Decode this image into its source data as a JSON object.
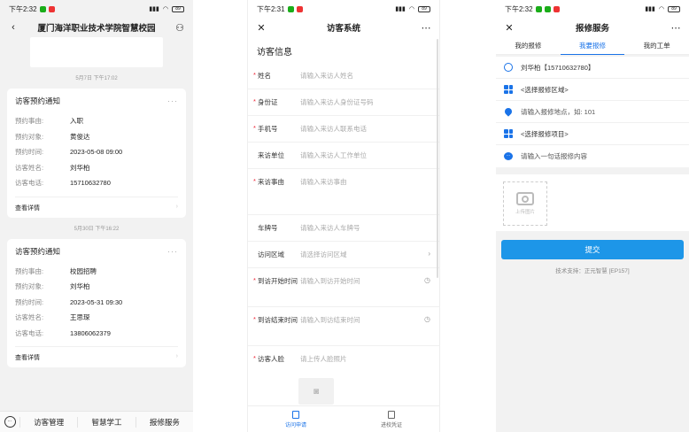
{
  "status_bar": {
    "p1_time": "下午2:32",
    "p2_time": "下午2:31",
    "p3_time": "下午2:32",
    "signal": "all",
    "battery": "89"
  },
  "phone1": {
    "title": "厦门海洋职业技术学院智慧校园",
    "cards": [
      {
        "date": "5月7日 下午17:02",
        "title": "访客预约通知",
        "rows": [
          {
            "k": "预约事由:",
            "v": "入职"
          },
          {
            "k": "预约对象:",
            "v": "黄俊达"
          },
          {
            "k": "预约时间:",
            "v": "2023-05-08 09:00"
          },
          {
            "k": "访客姓名:",
            "v": "刘华柏"
          },
          {
            "k": "访客电话:",
            "v": "15710632780"
          }
        ],
        "footer": "查看详情"
      },
      {
        "date": "5月30日 下午16:22",
        "title": "访客预约通知",
        "rows": [
          {
            "k": "预约事由:",
            "v": "校园招聘"
          },
          {
            "k": "预约对象:",
            "v": "刘华柏"
          },
          {
            "k": "预约时间:",
            "v": "2023-05-31 09:30"
          },
          {
            "k": "访客姓名:",
            "v": "王思琛"
          },
          {
            "k": "访客电话:",
            "v": "13806062379"
          }
        ],
        "footer": "查看详情"
      }
    ],
    "tabbar": [
      "访客管理",
      "智慧学工",
      "报修服务"
    ]
  },
  "phone2": {
    "title": "访客系统",
    "section": "访客信息",
    "fields": [
      {
        "label": "姓名",
        "placeholder": "请输入来访人姓名",
        "req": "*"
      },
      {
        "label": "身份证",
        "placeholder": "请输入来访人身份证号码",
        "req": "*"
      },
      {
        "label": "手机号",
        "placeholder": "请输入来访人联系电话",
        "req": "*"
      },
      {
        "label": "来访单位",
        "placeholder": "请输入来访人工作单位",
        "req": ""
      },
      {
        "label": "来访事由",
        "placeholder": "请输入来访事由",
        "req": "*"
      },
      {
        "label": "车牌号",
        "placeholder": "请输入来访人车牌号",
        "req": ""
      },
      {
        "label": "访问区域",
        "placeholder": "请选择访问区域",
        "req": ""
      },
      {
        "label": "到访开始时间",
        "placeholder": "请输入到访开始时间",
        "req": "*"
      },
      {
        "label": "到访结束时间",
        "placeholder": "请输入到访结束时间",
        "req": "*"
      },
      {
        "label": "访客人脸",
        "placeholder": "请上传人脸照片",
        "req": "*"
      }
    ],
    "tabbar": [
      "访问申请",
      "进校凭证"
    ]
  },
  "phone3": {
    "title": "报修服务",
    "tabs": [
      "我的报修",
      "我要报修",
      "我的工单"
    ],
    "rows": [
      {
        "icon": "user-icon",
        "text": "刘华柏【15710632780】"
      },
      {
        "icon": "grid-icon",
        "text": "<选择报修区域>"
      },
      {
        "icon": "location-icon",
        "text": "请输入报修地点，如: 101"
      },
      {
        "icon": "grid-icon",
        "text": "<选择报修项目>"
      },
      {
        "icon": "chat-icon",
        "text": "请输入一句话报修内容"
      }
    ],
    "upload_label": "上传图片",
    "submit": "提交",
    "tech": "技术支持：正元智慧 [EP157]"
  },
  "colors": {
    "accent": "#1a73e8",
    "submit": "#1d96e8",
    "required": "#ee2233"
  }
}
